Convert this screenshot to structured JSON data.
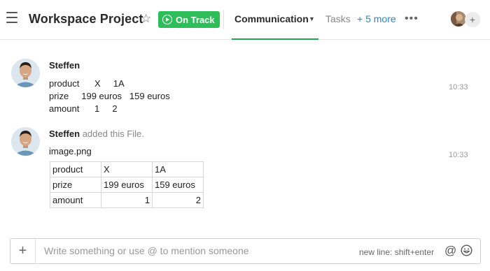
{
  "header": {
    "title": "Workspace Project",
    "status": "On Track",
    "tabs": {
      "communication": "Communication",
      "tasks": "Tasks",
      "more": "+ 5 more"
    },
    "more_menu": "•••",
    "add_member": "+"
  },
  "messages": [
    {
      "sender": "Steffen",
      "lines": [
        "product      X     1A",
        "prize     199 euros   159 euros",
        "amount      1     2"
      ],
      "time": "10:33"
    },
    {
      "sender": "Steffen",
      "action": "added this File.",
      "file_name": "image.png",
      "time": "10:33",
      "table": [
        [
          "product",
          "X",
          "1A"
        ],
        [
          "prize",
          "199 euros",
          "159 euros"
        ],
        [
          "amount",
          "1",
          "2"
        ]
      ]
    }
  ],
  "composer": {
    "placeholder": "Write something or use @ to mention someone",
    "hint": "new line: shift+enter",
    "at_symbol": "@",
    "plus": "+"
  },
  "icons": {
    "menu": "hamburger-icon",
    "star": "star-icon",
    "status": "play-circle-icon",
    "more": "more-dots-icon",
    "emoji": "smiley-icon"
  },
  "colors": {
    "status_green": "#2ebd59",
    "active_tab_underline": "#23a455",
    "link_blue": "#2a8ac0"
  }
}
